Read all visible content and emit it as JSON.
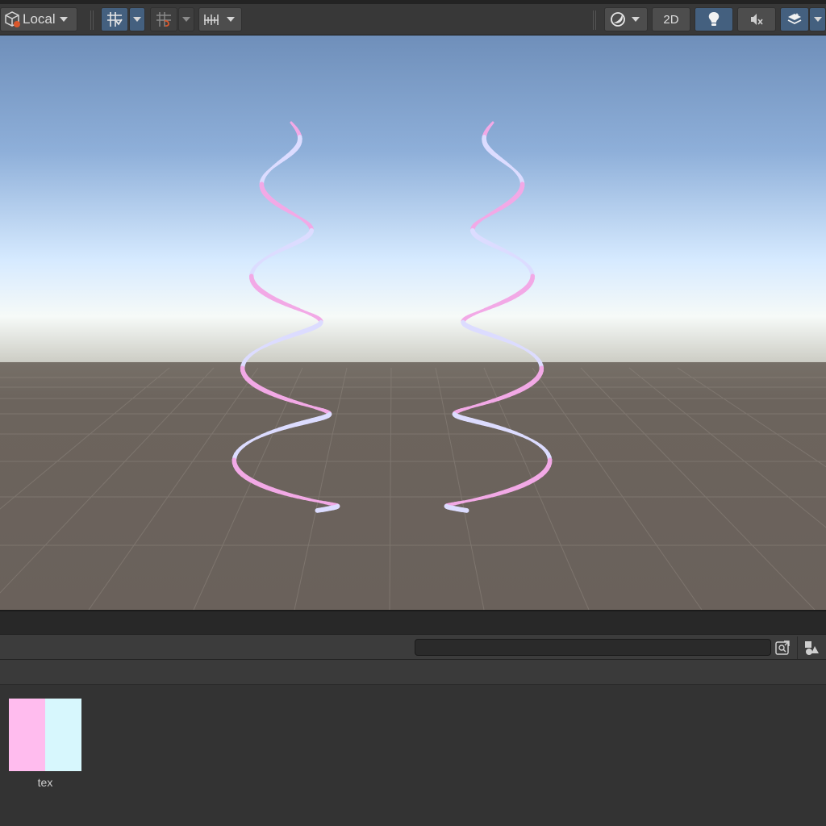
{
  "toolbar": {
    "pivot_label": "Local",
    "view_2d_label": "2D"
  },
  "icons": {
    "pivot": "box-pivot-icon",
    "grid": "grid-snap-icon",
    "grid2": "grid-increment-icon",
    "ruler": "ruler-icon",
    "shading": "shading-mode-icon",
    "lighting": "lightbulb-icon",
    "audio": "audio-mute-icon",
    "effects": "layers-effects-icon",
    "search": "search-icon",
    "save_search": "save-search-icon",
    "type_filter": "shapes-filter-icon"
  },
  "colors": {
    "active_button": "#44607f",
    "ribbon_pink": "#f2a9e6",
    "ribbon_lavender": "#dcdcff",
    "sky_top": "#6f8fba",
    "ground": "#6b635c"
  },
  "search": {
    "value": "",
    "placeholder": ""
  },
  "assets": [
    {
      "name": "tex",
      "swatch_left": "#ffbcee",
      "swatch_right": "#d7f7fd"
    }
  ]
}
